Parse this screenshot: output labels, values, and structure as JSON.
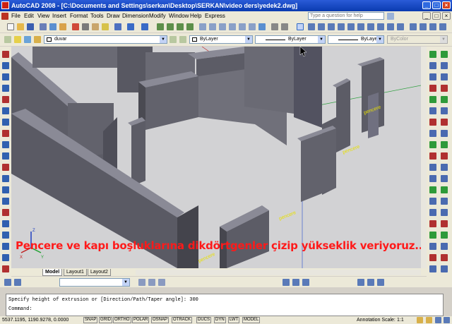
{
  "window": {
    "title": "AutoCAD 2008 - [C:\\Documents and Settings\\serkan\\Desktop\\SERKAN\\video ders\\yedek2.dwg]",
    "help_placeholder": "Type a question for help"
  },
  "menu": [
    "File",
    "Edit",
    "View",
    "Insert",
    "Format",
    "Tools",
    "Draw",
    "Dimension",
    "Modify",
    "Window",
    "Help",
    "Express"
  ],
  "layers_toolbar": {
    "layer_name": "duvar",
    "color": "ByLayer",
    "linetype": "ByLayer",
    "lineweight": "ByLayer",
    "plot_style": "ByColor"
  },
  "viewport": {
    "overlay_caption": "Pencere ve kapı boşluklarına dikdörtgenler çizip yükseklik veriyoruz..",
    "labels": [
      "pencere",
      "pencere",
      "pencere",
      "pencere"
    ],
    "ucs_x": "X",
    "ucs_y": "Y",
    "ucs_z": "Z"
  },
  "layout_tabs": [
    "Model",
    "Layout1",
    "Layout2"
  ],
  "command_window": {
    "line1": "Specify height of extrusion or [Direction/Path/Taper angle]: 300",
    "line2": "Command:"
  },
  "status_bar": {
    "coordinates": "5537.1195, 1190.9278, 0.0000",
    "toggles": [
      "SNAP",
      "GRID",
      "ORTHO",
      "POLAR",
      "OSNAP",
      "OTRACK",
      "DUCS",
      "DYN",
      "LWT",
      "MODEL"
    ],
    "annotation_scale_label": "Annotation Scale:",
    "annotation_scale_value": "1:1"
  },
  "colors": {
    "title_bar": "#0a3bb0",
    "viewport_bg": "#d2d2d4",
    "wall_top": "#8a8a96",
    "wall_side": "#5c5c66",
    "caption": "#ff1a1a",
    "label": "#e8e000"
  }
}
